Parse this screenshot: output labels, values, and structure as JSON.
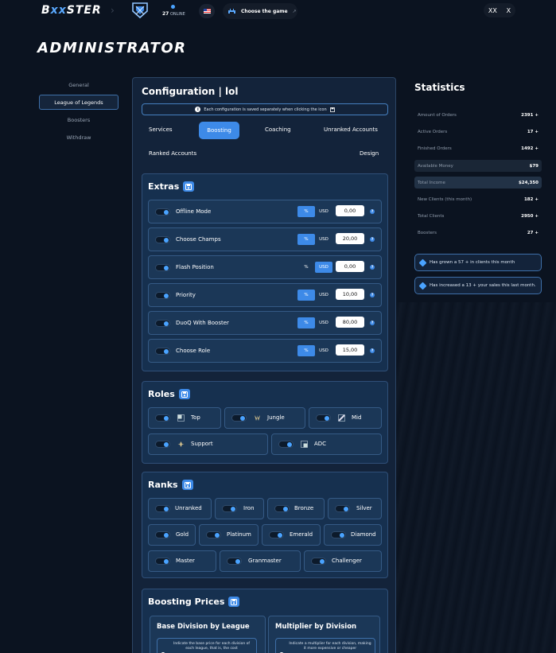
{
  "topbar": {
    "logo_part1": "B",
    "logo_part2": "xx",
    "logo_part3": "STER",
    "online_count": "27",
    "online_label": "ONLINE",
    "flag": "US",
    "game_selector_label": "Choose the game",
    "user_initials": "XX",
    "close_glyph": "X"
  },
  "page_title": "ADMINISTRATOR",
  "nav": {
    "items": [
      {
        "label": "General",
        "active": false
      },
      {
        "label": "League of Legends",
        "active": true
      },
      {
        "label": "Boosters",
        "active": false
      },
      {
        "label": "Withdraw",
        "active": false
      }
    ]
  },
  "config": {
    "title": "Configuration | lol",
    "notice": "Each configuration is saved separately when clicking the icon",
    "tabs": [
      {
        "label": "Services",
        "active": false
      },
      {
        "label": "Boosting",
        "active": true
      },
      {
        "label": "Coaching",
        "active": false
      },
      {
        "label": "Unranked Accounts",
        "active": false
      },
      {
        "label": "Ranked Accounts",
        "active": false
      },
      {
        "label": "Design",
        "active": false
      }
    ]
  },
  "extras": {
    "title": "Extras",
    "rows": [
      {
        "label": "Offline Mode",
        "pct": "%",
        "usd": "USD",
        "mode": "percent",
        "value": "0,00"
      },
      {
        "label": "Choose Champs",
        "pct": "%",
        "usd": "USD",
        "mode": "percent",
        "value": "20,00"
      },
      {
        "label": "Flash Position",
        "pct": "%",
        "usd": "USD",
        "mode": "usd",
        "value": "0,00"
      },
      {
        "label": "Priority",
        "pct": "%",
        "usd": "USD",
        "mode": "percent",
        "value": "10,00"
      },
      {
        "label": "DuoQ With Booster",
        "pct": "%",
        "usd": "USD",
        "mode": "percent",
        "value": "80,00"
      },
      {
        "label": "Choose Role",
        "pct": "%",
        "usd": "USD",
        "mode": "percent",
        "value": "15,00"
      }
    ]
  },
  "roles": {
    "title": "Roles",
    "items": [
      "Top",
      "Jungle",
      "Mid",
      "Support",
      "ADC"
    ]
  },
  "ranks": {
    "title": "Ranks",
    "items": [
      "Unranked",
      "Iron",
      "Bronze",
      "Silver",
      "Gold",
      "Platinum",
      "Emerald",
      "Diamond",
      "Master",
      "Granmaster",
      "Challenger"
    ]
  },
  "boosting_prices": {
    "title": "Boosting Prices",
    "base": {
      "title": "Base Division by League",
      "desc": "Indicate the base price for each division of each league, that is, the cost"
    },
    "multiplier": {
      "title": "Multiplier by Division",
      "desc": "Indicate a multiplier for each division, making it more expensive or cheaper"
    }
  },
  "stats": {
    "title": "Statistics",
    "rows": [
      {
        "label": "Amount of Orders",
        "value": "2391 +"
      },
      {
        "label": "Active Orders",
        "value": "17 +"
      },
      {
        "label": "Finished Orders",
        "value": "1492 +"
      },
      {
        "label": "Available Money",
        "value": "$79"
      },
      {
        "label": "Total Income",
        "value": "$24,350"
      },
      {
        "label": "New Clients (this month)",
        "value": "182 +"
      },
      {
        "label": "Total Clients",
        "value": "2950 +"
      },
      {
        "label": "Boosters",
        "value": "27 +"
      }
    ],
    "pills": [
      "Has grown a  57 + in clients this month",
      "Has increased a  13 + your sales this last month."
    ]
  },
  "colors": {
    "accent": "#3d8ae8",
    "background": "#0b1320",
    "panel": "#13233a"
  }
}
